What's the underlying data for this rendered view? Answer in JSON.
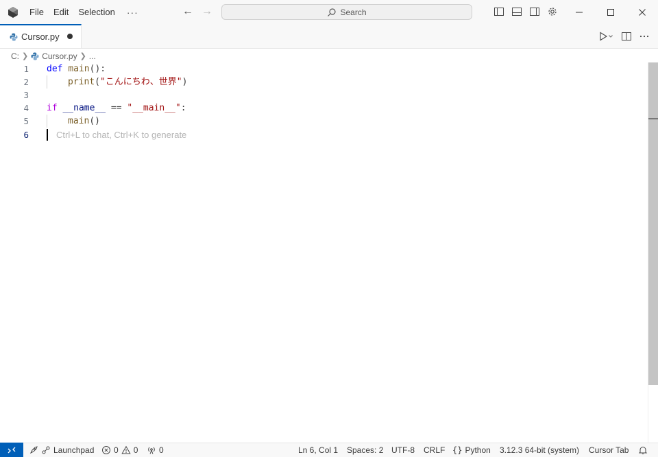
{
  "menu": {
    "file": "File",
    "edit": "Edit",
    "selection": "Selection",
    "more": "···"
  },
  "search": {
    "label": "Search"
  },
  "tab": {
    "label": "Cursor.py"
  },
  "breadcrumb": {
    "drive": "C:",
    "file": "Cursor.py",
    "more": "..."
  },
  "editor": {
    "line_numbers": [
      "1",
      "2",
      "3",
      "4",
      "5",
      "6"
    ],
    "code": {
      "l1_kw": "def",
      "l1_fn": "main",
      "l1_rest": "():",
      "l2_fn": "print",
      "l2_open": "(",
      "l2_str": "\"こんにちわ、世界\"",
      "l2_close": ")",
      "l4_kw": "if",
      "l4_var": "__name__",
      "l4_op": " == ",
      "l4_str": "\"__main__\"",
      "l4_colon": ":",
      "l5_fn": "main",
      "l5_rest": "()"
    },
    "inline_hint": "Ctrl+L to chat, Ctrl+K to generate"
  },
  "status": {
    "launchpad": "Launchpad",
    "errors": "0",
    "warnings": "0",
    "ports": "0",
    "position": "Ln 6, Col 1",
    "spaces": "Spaces: 2",
    "encoding": "UTF-8",
    "eol": "CRLF",
    "language": "Python",
    "interpreter": "3.12.3 64-bit (system)",
    "cursor_tab": "Cursor Tab"
  },
  "colors": {
    "accent": "#005fb8",
    "keyword": "#0000ff",
    "control_keyword": "#af00db",
    "function": "#795e26",
    "string": "#a31515",
    "variable": "#001080"
  }
}
